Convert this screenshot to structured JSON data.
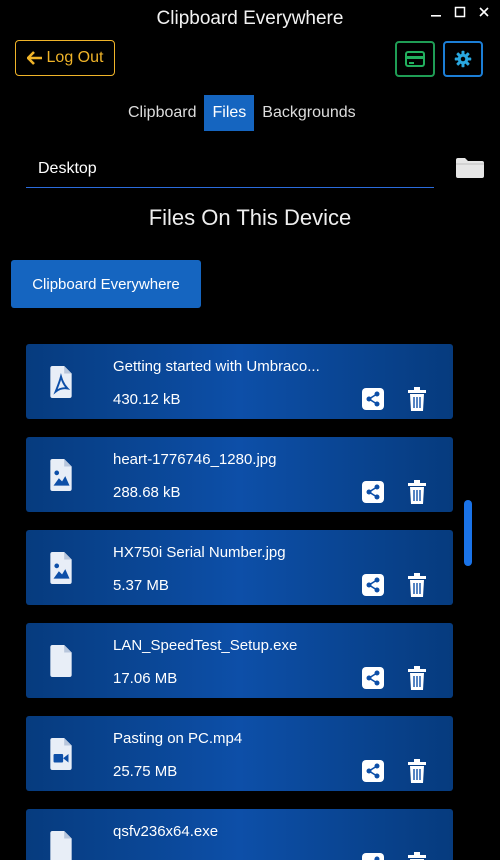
{
  "window": {
    "title": "Clipboard Everywhere",
    "controls": [
      "minimize-icon",
      "maximize-icon",
      "close-icon"
    ]
  },
  "toolbar": {
    "logout_label": "Log Out",
    "card_icon": "credit-card-icon",
    "settings_icon": "gear-icon"
  },
  "tabs": [
    {
      "label": "Clipboard",
      "active": false
    },
    {
      "label": "Files",
      "active": true
    },
    {
      "label": "Backgrounds",
      "active": false
    }
  ],
  "path": {
    "value": "Desktop",
    "icon": "folder-icon"
  },
  "main": {
    "heading": "Files On This Device",
    "device_button": "Clipboard Everywhere"
  },
  "files": [
    {
      "name": "Getting started with Umbraco...",
      "size": "430.12 kB",
      "icon": "pdf-file-icon"
    },
    {
      "name": "heart-1776746_1280.jpg",
      "size": "288.68 kB",
      "icon": "image-file-icon"
    },
    {
      "name": "HX750i Serial Number.jpg",
      "size": "5.37 MB",
      "icon": "image-file-icon"
    },
    {
      "name": "LAN_SpeedTest_Setup.exe",
      "size": "17.06 MB",
      "icon": "file-icon"
    },
    {
      "name": "Pasting on PC.mp4",
      "size": "25.75 MB",
      "icon": "video-file-icon"
    },
    {
      "name": "qsfv236x64.exe",
      "size": "",
      "icon": "file-icon"
    }
  ],
  "colors": {
    "accent": "#1565c0",
    "logout": "#f0b429",
    "card_border": "#1f9d55",
    "settings_border": "#1c7ed6",
    "background": "#000000"
  }
}
